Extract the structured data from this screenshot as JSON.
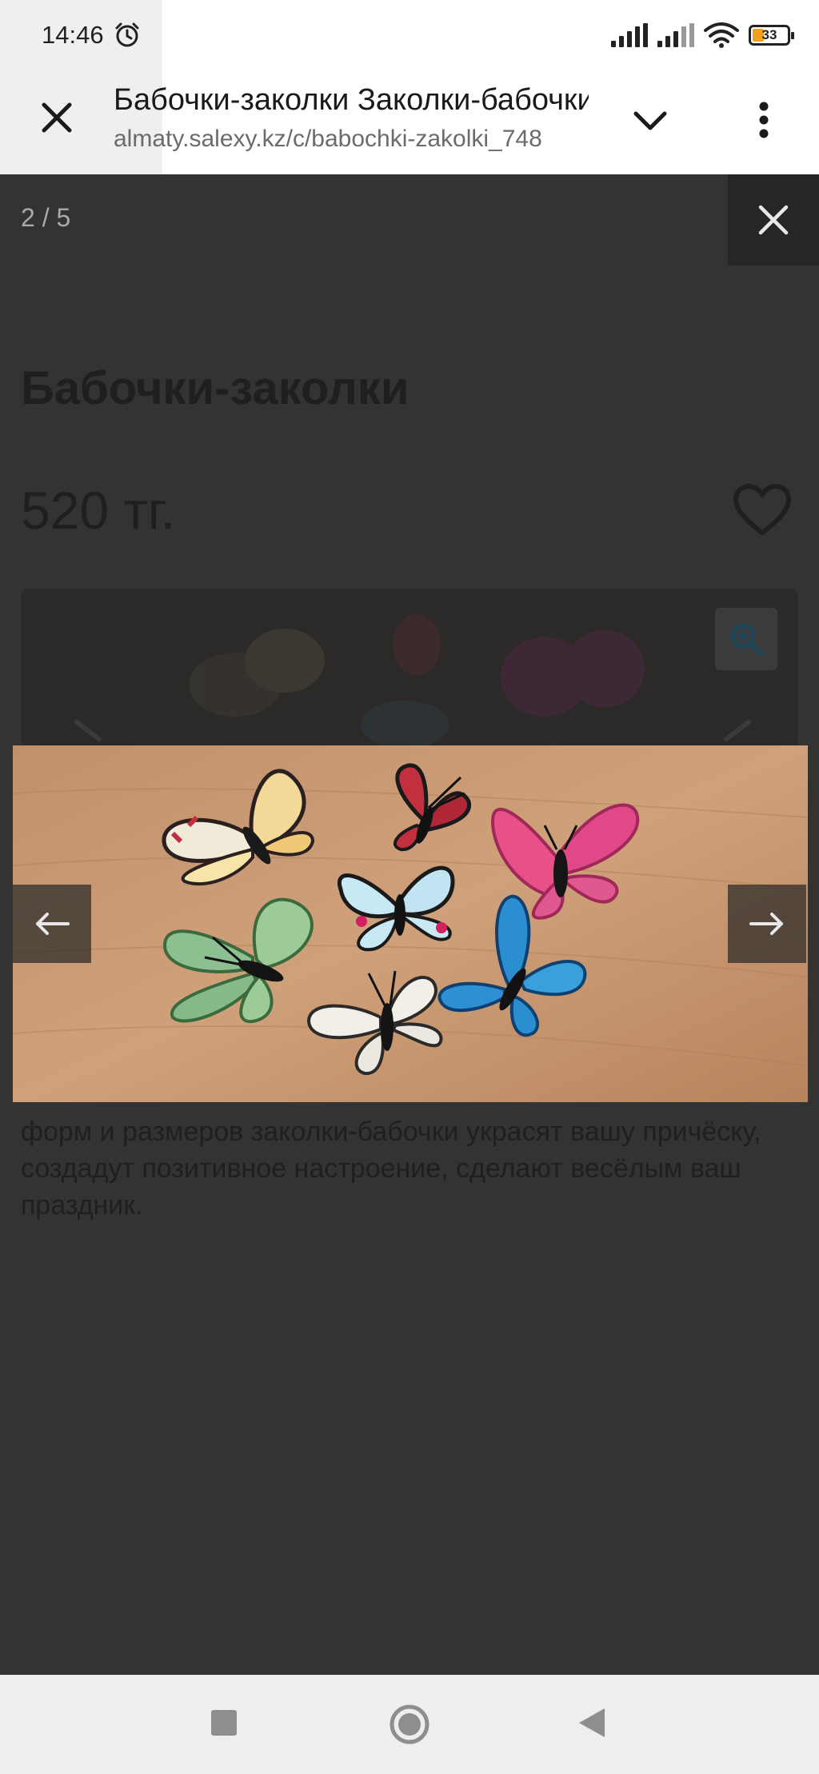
{
  "status_bar": {
    "time": "14:46",
    "battery": "33",
    "icons": [
      "alarm-icon",
      "signal-icon",
      "signal-icon",
      "wifi-icon",
      "battery-icon"
    ]
  },
  "browser": {
    "page_title": "Бабочки-заколки Заколки-бабочки",
    "url": "almaty.salexy.kz/c/babochki-zakolki_748"
  },
  "lightbox": {
    "counter": "2 / 5",
    "icons": [
      "close-icon",
      "arrow-left-icon",
      "arrow-right-icon"
    ]
  },
  "product": {
    "title": "Бабочки-заколки",
    "price": "520 тг.",
    "description": "форм и размеров заколки-бабочки украсят вашу причёску, создадут позитивное настроение, сделают весёлым ваш праздник."
  },
  "colors": {
    "overlay": "#333333",
    "wood": "#c89a72"
  }
}
